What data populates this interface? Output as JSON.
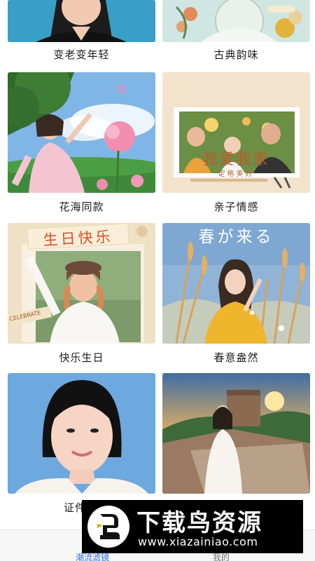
{
  "cards": {
    "row0_left": {
      "label": "变老变年轻"
    },
    "row0_right": {
      "label": "古典韵味"
    },
    "row1_left": {
      "label": "花海同款"
    },
    "row1_right": {
      "label": "亲子情感",
      "poster_title": "我爱我家",
      "poster_sub": "定格美好"
    },
    "row2_left": {
      "label": "快乐生日",
      "poster_title": "生日快乐",
      "tag": "CELEBRATE"
    },
    "row2_right": {
      "label": "春意盎然",
      "poster_title": "春が来る"
    },
    "row3_left": {
      "label": "证件"
    },
    "row3_right": {
      "label": ""
    }
  },
  "tabbar": {
    "active_label": "潮流滤镜",
    "mine_label": "我的",
    "accent": "#2f6fe4"
  },
  "watermark": {
    "title": "下载鸟资源",
    "url": "www.xiazainiao.com",
    "icon": "bird-logo-icon"
  }
}
